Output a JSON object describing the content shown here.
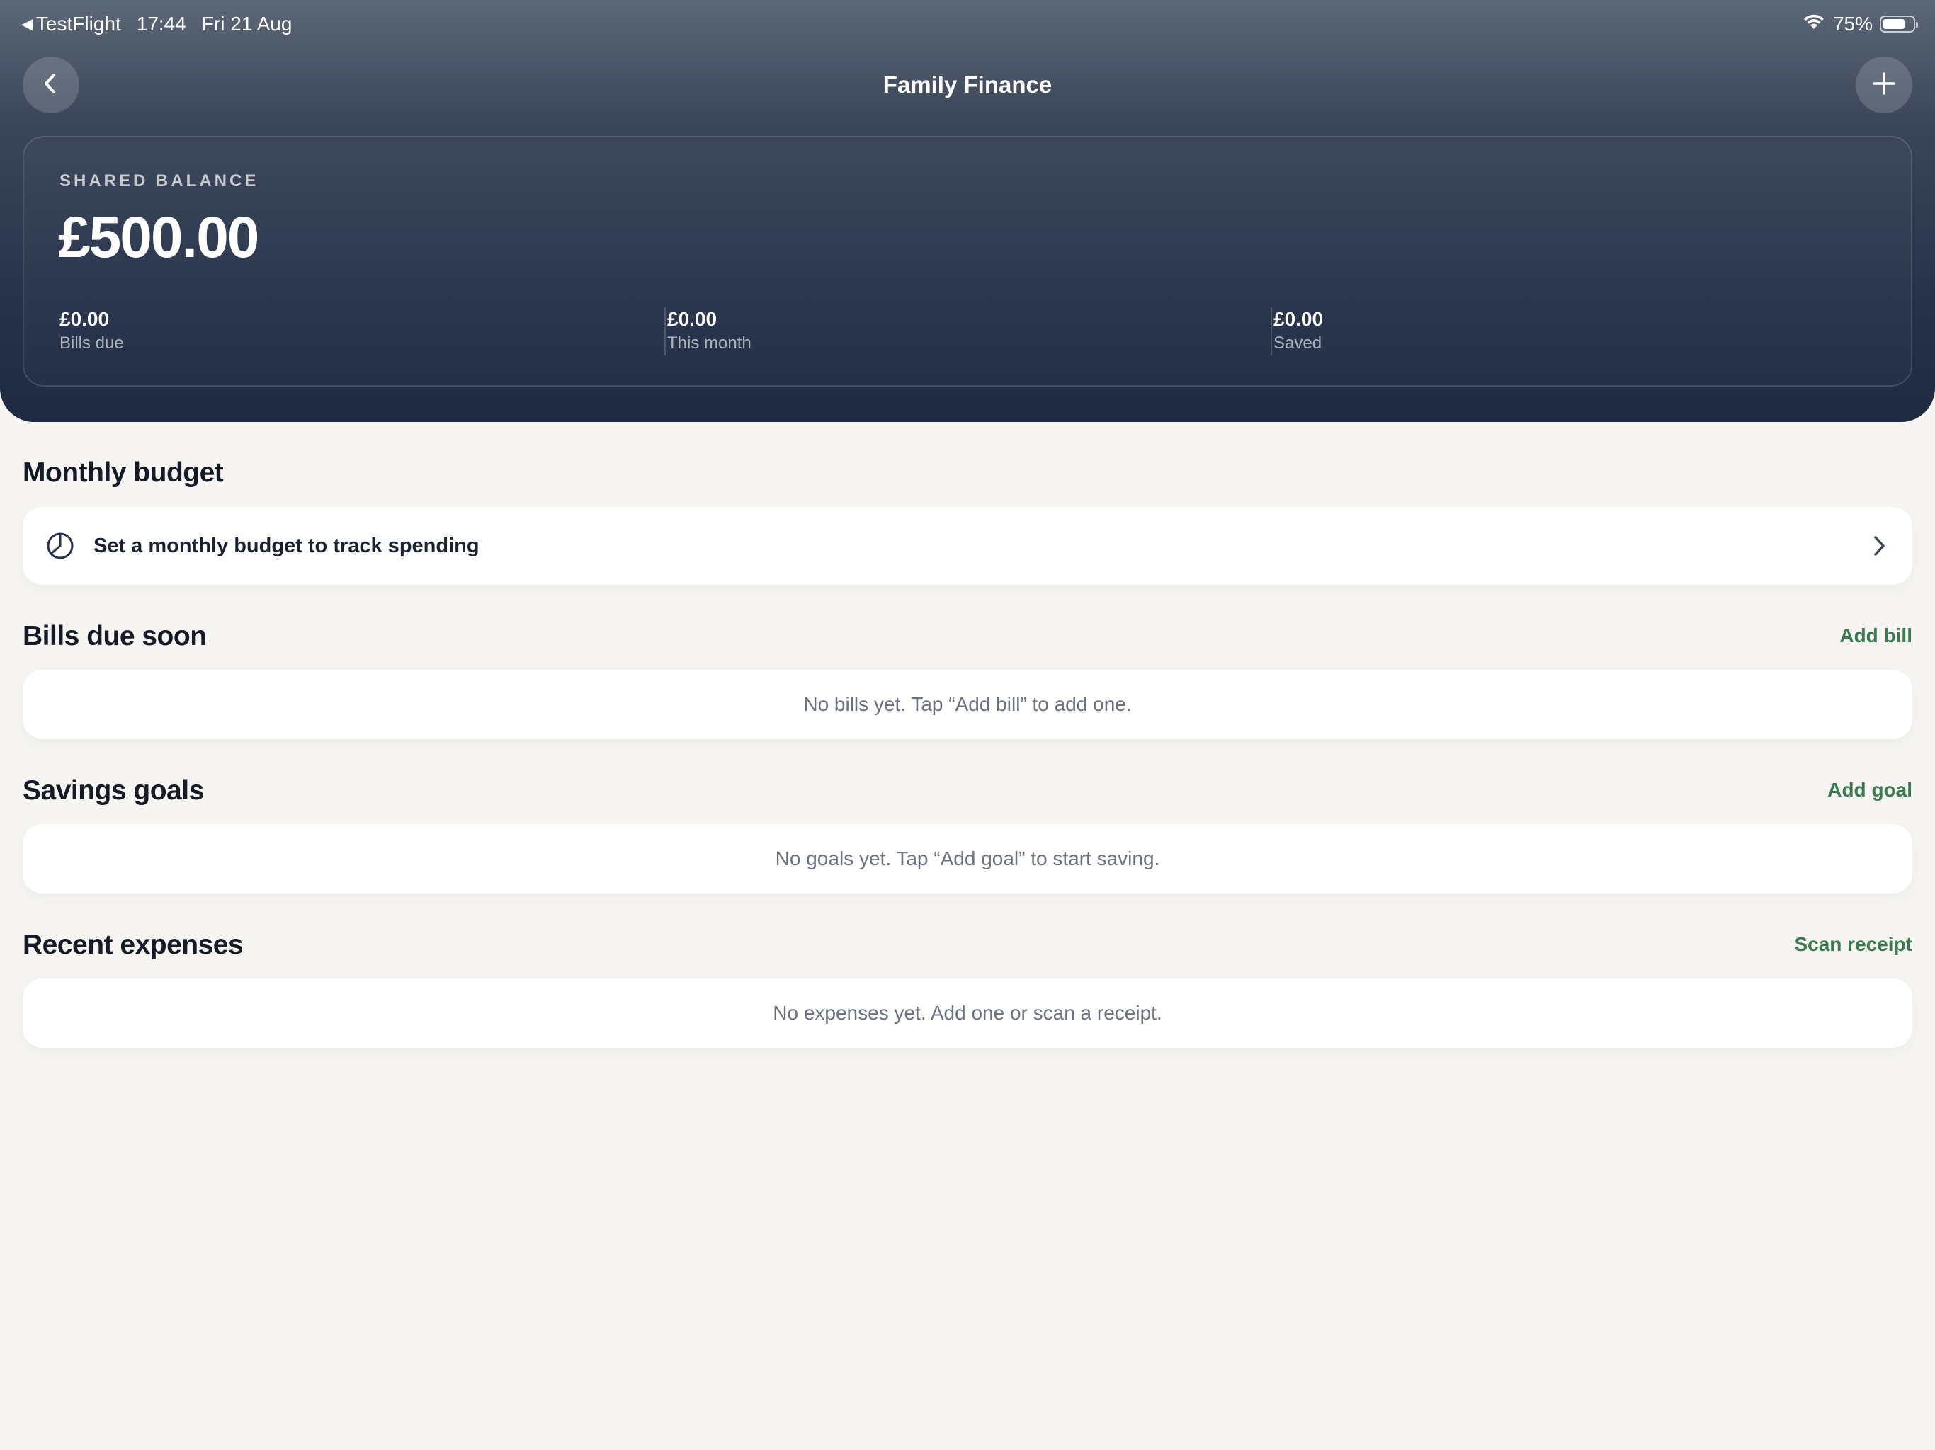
{
  "status_bar": {
    "back_app": "TestFlight",
    "time": "17:44",
    "date": "Fri 21 Aug",
    "battery_text": "75%",
    "battery_level": 0.75,
    "wifi_icon": "wifi-icon"
  },
  "nav": {
    "title": "Family Finance",
    "back_icon": "chevron-left-icon",
    "add_icon": "plus-icon"
  },
  "balance": {
    "label": "SHARED BALANCE",
    "amount": "£500.00",
    "stats": [
      {
        "value": "£0.00",
        "label": "Bills due"
      },
      {
        "value": "£0.00",
        "label": "This month"
      },
      {
        "value": "£0.00",
        "label": "Saved"
      }
    ]
  },
  "monthly_budget": {
    "title": "Monthly budget",
    "row_text": "Set a monthly budget to track spending",
    "icon": "pie-chart-icon"
  },
  "bills": {
    "title": "Bills due soon",
    "action": "Add bill",
    "empty": "No bills yet. Tap “Add bill” to add one."
  },
  "goals": {
    "title": "Savings goals",
    "action": "Add goal",
    "empty": "No goals yet. Tap “Add goal” to start saving."
  },
  "expenses": {
    "title": "Recent expenses",
    "action": "Scan receipt",
    "empty": "No expenses yet. Add one or scan a receipt."
  },
  "colors": {
    "accent_green": "#3c7a50",
    "header_top": "#5c6878",
    "header_bottom": "#1d2a40",
    "background": "#f6f5f1"
  }
}
